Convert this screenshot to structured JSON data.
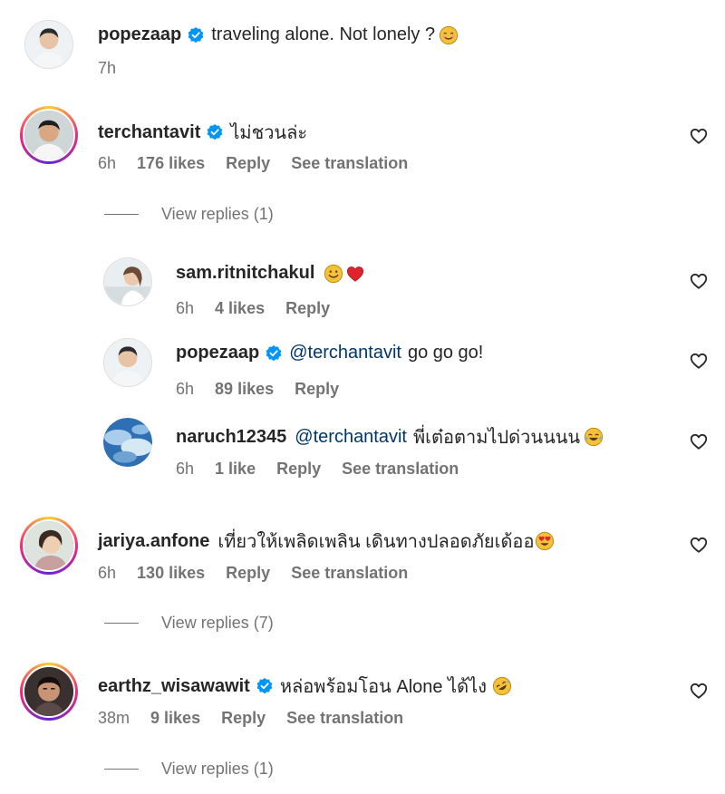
{
  "comments": [
    {
      "username": "popezaap",
      "verified": true,
      "text": "traveling alone. Not lonely ?",
      "time": "7h"
    },
    {
      "username": "terchantavit",
      "verified": true,
      "text": "ไม่ชวนล่ะ",
      "time": "6h",
      "likes": "176 likes",
      "reply": "Reply",
      "translation": "See translation",
      "view_replies": "View replies (1)"
    },
    {
      "username": "sam.ritnitchakul",
      "verified": false,
      "text": "",
      "time": "6h",
      "likes": "4 likes",
      "reply": "Reply"
    },
    {
      "username": "popezaap",
      "verified": true,
      "mention": "@terchantavit",
      "text": "go go go!",
      "time": "6h",
      "likes": "89 likes",
      "reply": "Reply"
    },
    {
      "username": "naruch12345",
      "verified": false,
      "mention": "@terchantavit",
      "text": "พี่เต๋อตามไปด่วนนนน",
      "time": "6h",
      "likes": "1 like",
      "reply": "Reply",
      "translation": "See translation"
    },
    {
      "username": "jariya.anfone",
      "verified": false,
      "text": "เที่ยวให้เพลิดเพลิน เดินทางปลอดภัยเด้ออ",
      "time": "6h",
      "likes": "130 likes",
      "reply": "Reply",
      "translation": "See translation",
      "view_replies": "View replies (7)"
    },
    {
      "username": "earthz_wisawawit",
      "verified": true,
      "text": "หล่อพร้อมโอน Alone ได้ไง",
      "time": "38m",
      "likes": "9 likes",
      "reply": "Reply",
      "translation": "See translation",
      "view_replies": "View replies (1)"
    }
  ],
  "colors": {
    "text": "#262626",
    "meta": "#737373",
    "verified": "#0095f6",
    "mention": "#00376b",
    "story_ring": [
      "#f9ce34",
      "#ee2a7b",
      "#6228d7"
    ]
  },
  "icons": {
    "verified": "verified-badge-icon",
    "like": "heart-outline-icon",
    "emojis": [
      "smiling-face-icon",
      "grinning-face-icon",
      "red-heart-icon",
      "tears-of-joy-face-icon",
      "heart-eyes-face-icon",
      "rolling-laughing-face-icon"
    ]
  }
}
